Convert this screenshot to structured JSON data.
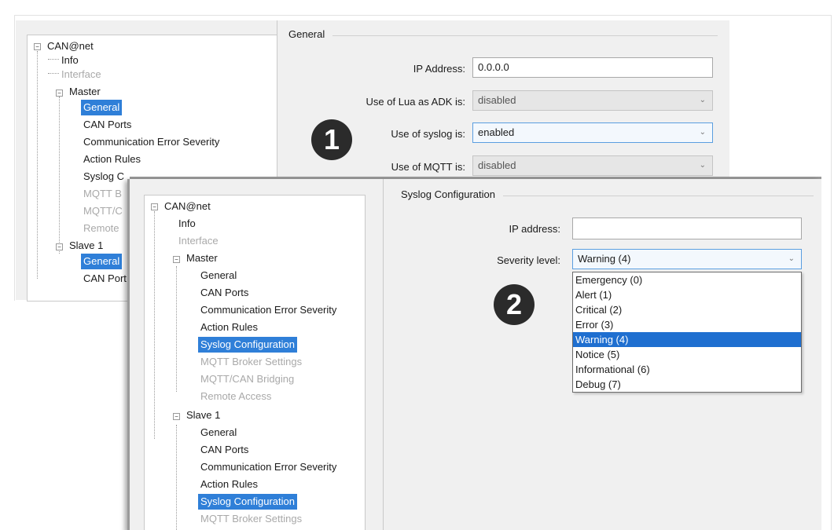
{
  "window1": {
    "tree": {
      "root": "CAN@net",
      "items": [
        {
          "label": "Info",
          "state": "normal"
        },
        {
          "label": "Interface",
          "state": "disabled"
        },
        {
          "label": "Master",
          "state": "normal"
        },
        {
          "label": "General",
          "state": "selected"
        },
        {
          "label": "CAN Ports",
          "state": "normal"
        },
        {
          "label": "Communication Error Severity",
          "state": "normal"
        },
        {
          "label": "Action Rules",
          "state": "normal"
        },
        {
          "label": "Syslog C",
          "state": "normal"
        },
        {
          "label": "MQTT B",
          "state": "disabled"
        },
        {
          "label": "MQTT/C",
          "state": "disabled"
        },
        {
          "label": "Remote",
          "state": "disabled"
        },
        {
          "label": "Slave 1",
          "state": "normal"
        },
        {
          "label": "General",
          "state": "selected"
        },
        {
          "label": "CAN Port",
          "state": "normal"
        }
      ]
    },
    "general": {
      "title": "General",
      "ip_label": "IP Address:",
      "ip_value": "0.0.0.0",
      "lua_label": "Use of Lua as ADK is:",
      "lua_value": "disabled",
      "syslog_label": "Use of syslog is:",
      "syslog_value": "enabled",
      "mqtt_label": "Use of MQTT is:",
      "mqtt_value": "disabled"
    },
    "badge": "1"
  },
  "window2": {
    "tree": {
      "root": "CAN@net",
      "items": [
        {
          "label": "Info",
          "state": "normal"
        },
        {
          "label": "Interface",
          "state": "disabled"
        },
        {
          "label": "Master",
          "state": "normal"
        },
        {
          "label": "General",
          "state": "normal"
        },
        {
          "label": "CAN Ports",
          "state": "normal"
        },
        {
          "label": "Communication Error Severity",
          "state": "normal"
        },
        {
          "label": "Action Rules",
          "state": "normal"
        },
        {
          "label": "Syslog Configuration",
          "state": "selected"
        },
        {
          "label": "MQTT Broker Settings",
          "state": "disabled"
        },
        {
          "label": "MQTT/CAN Bridging",
          "state": "disabled"
        },
        {
          "label": "Remote Access",
          "state": "disabled"
        },
        {
          "label": "Slave 1",
          "state": "normal"
        },
        {
          "label": "General",
          "state": "normal"
        },
        {
          "label": "CAN Ports",
          "state": "normal"
        },
        {
          "label": "Communication Error Severity",
          "state": "normal"
        },
        {
          "label": "Action Rules",
          "state": "normal"
        },
        {
          "label": "Syslog Configuration",
          "state": "selected"
        },
        {
          "label": "MQTT Broker Settings",
          "state": "disabled"
        }
      ]
    },
    "syslog": {
      "title": "Syslog Configuration",
      "ip_label": "IP address:",
      "ip_value": "",
      "severity_label": "Severity level:",
      "severity_value": "Warning (4)",
      "options": [
        "Emergency (0)",
        "Alert (1)",
        "Critical (2)",
        "Error (3)",
        "Warning (4)",
        "Notice (5)",
        "Informational (6)",
        "Debug (7)"
      ],
      "selected_index": 4
    },
    "badge": "2"
  },
  "icons": {
    "expand_toggle": "minus-box-icon",
    "dropdown_arrow": "chevron-down-icon"
  }
}
